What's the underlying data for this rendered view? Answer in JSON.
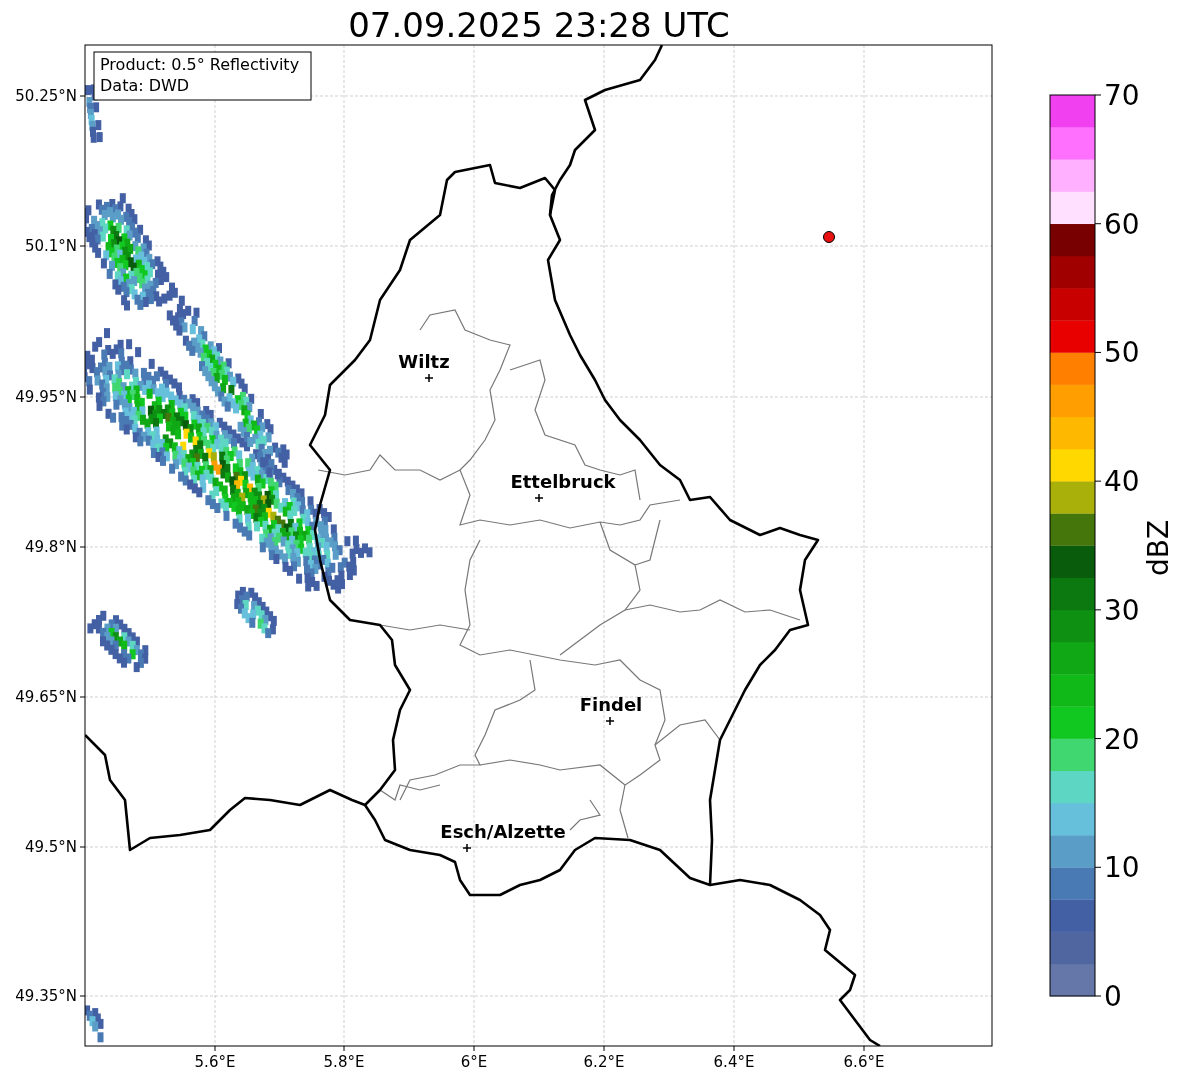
{
  "title": "07.09.2025 23:28 UTC",
  "info_box": {
    "lines": [
      "Product: 0.5° Reflectivity",
      "Data: DWD"
    ]
  },
  "map": {
    "x_ticks": [
      "5.6°E",
      "5.8°E",
      "6°E",
      "6.2°E",
      "6.4°E",
      "6.6°E"
    ],
    "y_ticks": [
      "50.25°N",
      "50.1°N",
      "49.95°N",
      "49.8°N",
      "49.65°N",
      "49.5°N",
      "49.35°N"
    ],
    "places": [
      {
        "name": "Wiltz"
      },
      {
        "name": "Ettelbruck"
      },
      {
        "name": "Findel"
      },
      {
        "name": "Esch/Alzette"
      }
    ]
  },
  "colorbar": {
    "label": "dBZ",
    "ticks": [
      "70",
      "60",
      "50",
      "40",
      "30",
      "20",
      "10",
      "0"
    ],
    "bands": [
      {
        "color": "#6477a8"
      },
      {
        "color": "#5066a0"
      },
      {
        "color": "#4460a4"
      },
      {
        "color": "#4a7ab4"
      },
      {
        "color": "#5a9ec8"
      },
      {
        "color": "#66c0dc"
      },
      {
        "color": "#5ed6c4"
      },
      {
        "color": "#40d670"
      },
      {
        "color": "#10c820"
      },
      {
        "color": "#10b818"
      },
      {
        "color": "#10a814"
      },
      {
        "color": "#0e9012"
      },
      {
        "color": "#0c7810"
      },
      {
        "color": "#085c0c"
      },
      {
        "color": "#44760c"
      },
      {
        "color": "#aab00a"
      },
      {
        "color": "#ffd800"
      },
      {
        "color": "#ffb800"
      },
      {
        "color": "#ff9e00"
      },
      {
        "color": "#ff8000"
      },
      {
        "color": "#e80000"
      },
      {
        "color": "#c80000"
      },
      {
        "color": "#a00000"
      },
      {
        "color": "#780000"
      },
      {
        "color": "#ffe0ff"
      },
      {
        "color": "#ffb0ff"
      },
      {
        "color": "#ff70ff"
      },
      {
        "color": "#f040f0"
      }
    ]
  }
}
